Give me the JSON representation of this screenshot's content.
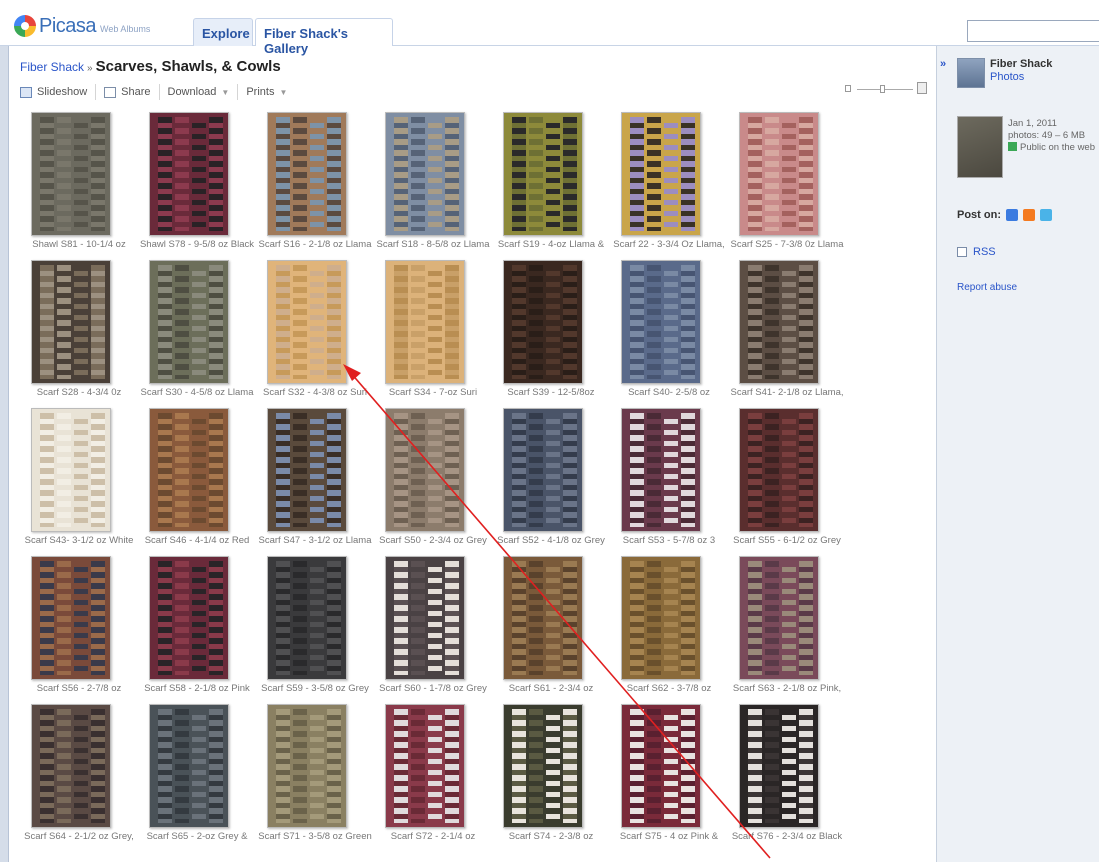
{
  "header": {
    "logo_text": "Picasa",
    "logo_sub": "Web Albums",
    "tabs": [
      {
        "label": "Explore"
      },
      {
        "label": "Fiber Shack's Gallery"
      }
    ]
  },
  "breadcrumb": {
    "owner": "Fiber Shack",
    "separator": "»",
    "album": "Scarves, Shawls, & Cowls"
  },
  "toolbar": {
    "slideshow": "Slideshow",
    "share": "Share",
    "download": "Download",
    "prints": "Prints"
  },
  "photos": [
    {
      "caption": "Shawl S81 - 10-1/4 oz",
      "colors": [
        "#6c6a5f",
        "#56544a",
        "#7a776b"
      ]
    },
    {
      "caption": "Shawl S78 - 9-5/8 oz Black",
      "colors": [
        "#6a2a3a",
        "#2a2226",
        "#8c3a4e"
      ]
    },
    {
      "caption": "Scarf S16 - 2-1/8 oz Llama",
      "colors": [
        "#a07a5a",
        "#7d93a8",
        "#5b4a3f"
      ]
    },
    {
      "caption": "Scarf S18 - 8-5/8 oz Llama",
      "colors": [
        "#7f8ea3",
        "#a89c86",
        "#566377"
      ]
    },
    {
      "caption": "Scarf S19 - 4-oz Llama &",
      "colors": [
        "#8d8a3a",
        "#2a2a2a",
        "#6e7034"
      ]
    },
    {
      "caption": "Scarf 22 - 3-3/4 Oz Llama,",
      "colors": [
        "#c9a54a",
        "#9c8dc0",
        "#3a3226"
      ]
    },
    {
      "caption": "Scarf S25 - 7-3/8 0z Llama",
      "colors": [
        "#c98a8a",
        "#a4615e",
        "#d7a8a0"
      ]
    },
    {
      "caption": "Scarf S28 - 4-3/4 0z",
      "colors": [
        "#4a4038",
        "#7a6c5a",
        "#9c9080"
      ]
    },
    {
      "caption": "Scarf S30 - 4-5/8 oz Llama",
      "colors": [
        "#6c6e5a",
        "#8a8a7c",
        "#4e4e42"
      ]
    },
    {
      "caption": "Scarf S32 - 4-3/8 oz Suri",
      "colors": [
        "#e0b47a",
        "#cfae8c",
        "#c79a5a"
      ]
    },
    {
      "caption": "Scarf S34 - 7-oz Suri",
      "colors": [
        "#dcb27a",
        "#b98e52",
        "#c9a068"
      ]
    },
    {
      "caption": "Scarf S39 - 12-5/8oz",
      "colors": [
        "#3a2820",
        "#52382c",
        "#2a1e18"
      ]
    },
    {
      "caption": "Scarf S40- 2-5/8 oz",
      "colors": [
        "#5a6a8a",
        "#7a8aa4",
        "#475572"
      ]
    },
    {
      "caption": "Scarf S41- 2-1/8 oz Llama,",
      "colors": [
        "#5c4e44",
        "#8a7c70",
        "#3e342c"
      ]
    },
    {
      "caption": "Scarf S43- 3-1/2 oz White",
      "colors": [
        "#e9e3d6",
        "#cdbfa8",
        "#f2eee4"
      ]
    },
    {
      "caption": "Scarf S46 - 4-1/4 oz Red",
      "colors": [
        "#8a5a3c",
        "#6c4a30",
        "#a9784e"
      ]
    },
    {
      "caption": "Scarf S47 - 3-1/2 oz Llama",
      "colors": [
        "#5a4a3c",
        "#7a8aa8",
        "#3a2e26"
      ]
    },
    {
      "caption": "Scarf S50 - 2-3/4 oz Grey",
      "colors": [
        "#8c7c6c",
        "#a69484",
        "#6e6052"
      ]
    },
    {
      "caption": "Scarf S52 - 4-1/8 oz Grey",
      "colors": [
        "#4a5468",
        "#6a7488",
        "#343c4c"
      ]
    },
    {
      "caption": "Scarf S53 - 5-7/8 oz 3",
      "colors": [
        "#6a3a4c",
        "#e0d8dc",
        "#4a2a36"
      ]
    },
    {
      "caption": "Scarf S55 - 6-1/2 oz Grey",
      "colors": [
        "#5a2e2e",
        "#7a3e3e",
        "#3c2222"
      ]
    },
    {
      "caption": "Scarf S56 - 2-7/8 oz",
      "colors": [
        "#7a4a3a",
        "#3a3a4a",
        "#9a6a4a"
      ]
    },
    {
      "caption": "Scarf S58 - 2-1/8 oz Pink",
      "colors": [
        "#6a2a3a",
        "#2a2428",
        "#8a3a4a"
      ]
    },
    {
      "caption": "Scarf S59 - 3-5/8 oz Grey",
      "colors": [
        "#3a3a3c",
        "#505052",
        "#2a2a2c"
      ]
    },
    {
      "caption": "Scarf S60 - 1-7/8 oz Grey",
      "colors": [
        "#4a4244",
        "#e4ded8",
        "#5a5052"
      ]
    },
    {
      "caption": "Scarf S61 - 2-3/4 oz",
      "colors": [
        "#7a5a3a",
        "#9a7a52",
        "#5a422c"
      ]
    },
    {
      "caption": "Scarf S62 - 3-7/8 oz",
      "colors": [
        "#8a6a3a",
        "#a68450",
        "#6a502c"
      ]
    },
    {
      "caption": "Scarf S63 - 2-1/8 oz Pink,",
      "colors": [
        "#7a4a5a",
        "#9a8a7a",
        "#5a3a48"
      ]
    },
    {
      "caption": "Scarf S64 - 2-1/2 oz Grey,",
      "colors": [
        "#5a4a44",
        "#3a3030",
        "#7a6a5a"
      ]
    },
    {
      "caption": "Scarf S65 - 2-oz Grey &",
      "colors": [
        "#4a5258",
        "#6a727a",
        "#343a40"
      ]
    },
    {
      "caption": "Scarf S71 - 3-5/8 oz Green",
      "colors": [
        "#8a8062",
        "#a49a7a",
        "#6a624a"
      ]
    },
    {
      "caption": "Scarf S72 - 2-1/4 oz",
      "colors": [
        "#8a3a4a",
        "#e0dadc",
        "#6a2a36"
      ]
    },
    {
      "caption": "Scarf S74 - 2-3/8 oz",
      "colors": [
        "#3a3c2e",
        "#e8e4dc",
        "#5a5a42"
      ]
    },
    {
      "caption": "Scarf S75 - 4 oz Pink &",
      "colors": [
        "#7a2a3a",
        "#e8e2e0",
        "#5a2030"
      ]
    },
    {
      "caption": "Scarf S76 - 2-3/4 oz Black",
      "colors": [
        "#2a2626",
        "#e4e0dc",
        "#3a3434"
      ]
    }
  ],
  "sidebar": {
    "collapse": "»",
    "owner_name": "Fiber Shack",
    "owner_link": "Photos",
    "album_date": "Jan 1, 2011",
    "album_stats": "photos: 49 – 6 MB",
    "visibility": "Public on the web",
    "post_on": "Post on:",
    "rss": "RSS",
    "report": "Report abuse"
  }
}
